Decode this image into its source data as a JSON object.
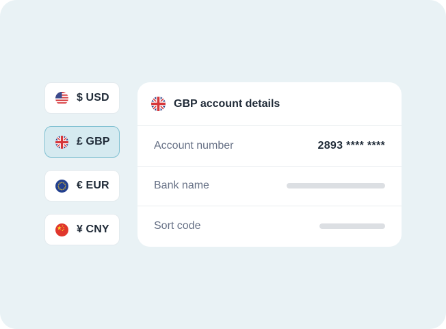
{
  "currencies": [
    {
      "label": "$ USD",
      "flag": "us-flag-icon",
      "selected": false
    },
    {
      "label": "£ GBP",
      "flag": "uk-flag-icon",
      "selected": true
    },
    {
      "label": "€ EUR",
      "flag": "eu-flag-icon",
      "selected": false
    },
    {
      "label": "¥ CNY",
      "flag": "cn-flag-icon",
      "selected": false
    }
  ],
  "details": {
    "title": "GBP account details",
    "flag": "uk-flag-icon",
    "rows": [
      {
        "label": "Account number",
        "value": "2893 **** ****"
      },
      {
        "label": "Bank name",
        "value": null,
        "redacted": true
      },
      {
        "label": "Sort code",
        "value": null,
        "redacted": true
      }
    ]
  },
  "colors": {
    "background": "#e9f2f5",
    "selected_fill": "#d5eaf0",
    "selected_border": "#7fc0d1",
    "text_primary": "#1f2a37",
    "text_secondary": "#667085",
    "placeholder": "#dcdfe3"
  }
}
